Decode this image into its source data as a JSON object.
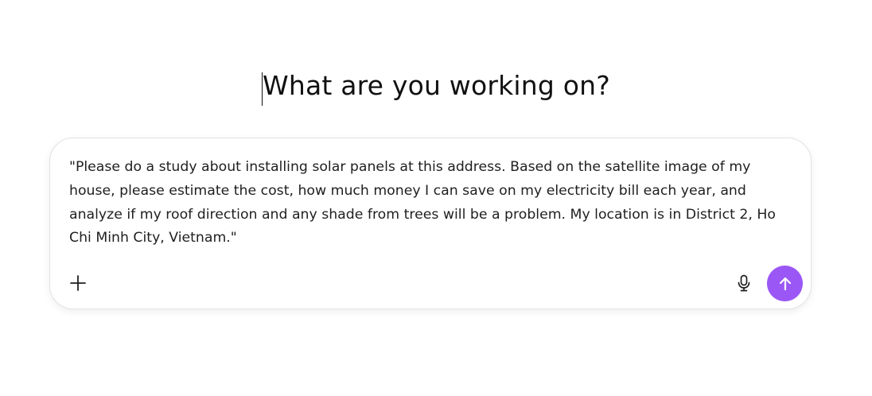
{
  "heading": {
    "title": "What are you working on?"
  },
  "composer": {
    "prompt_value": "\"Please do a study about installing solar panels at this address. Based on the satellite image of my house, please estimate the cost, how much money I can save on my electricity bill each year, and analyze if my roof direction and any shade from trees will be a problem. My location is in District 2, Ho Chi Minh City, Vietnam.\"",
    "buttons": {
      "add": "plus-icon",
      "voice": "microphone-icon",
      "send": "arrow-up-icon"
    }
  },
  "colors": {
    "send_button": "#9b57f6",
    "border": "#e3e3e3",
    "text": "#1f1f1f"
  }
}
